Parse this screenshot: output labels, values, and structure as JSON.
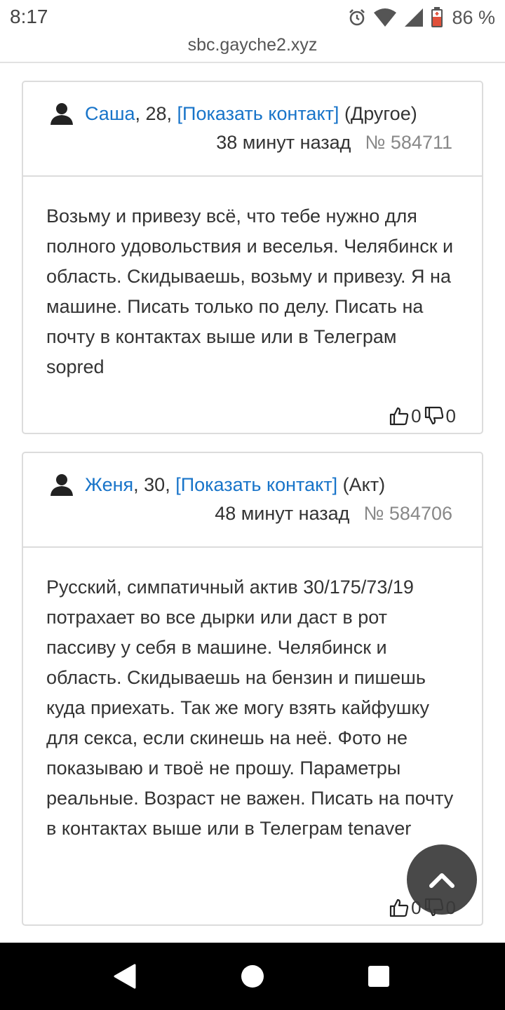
{
  "status_bar": {
    "time": "8:17",
    "battery_percent": "86 %",
    "icons": [
      "alarm-icon",
      "wifi-icon",
      "signal-icon",
      "battery-charging-icon"
    ]
  },
  "browser": {
    "url": "sbc.gayche2.xyz"
  },
  "posts": [
    {
      "name": "Саша",
      "age_sep": ", 28, ",
      "contact_link": "[Показать контакт]",
      "role": " (Другое)",
      "time_ago": "38 минут назад",
      "number": "№ 584711",
      "body": "Возьму и привезу всё, что тебе нужно для полного удовольствия и веселья. Челябинск и область. Скидываешь, возьму и привезу. Я на машине. Писать только по делу. Писать на почту в контактах выше или в Телеграм sopred",
      "likes": "0",
      "dislikes": "0"
    },
    {
      "name": "Женя",
      "age_sep": ", 30, ",
      "contact_link": "[Показать контакт]",
      "role": " (Акт)",
      "time_ago": "48 минут назад",
      "number": "№ 584706",
      "body": "Русский, симпатичный актив 30/175/73/19 потрахает во все дырки или даст в рот пассиву у себя в машине. Челябинск и область. Скидываешь на бензин и пишешь куда приехать. Так же могу взять кайфушку для секса, если скинешь на неё. Фото не показываю и твоё не прошу. Параметры реальные. Возраст не важен. Писать на почту в контактах выше или в Телеграм tenaver",
      "likes": "0",
      "dislikes": "0"
    }
  ],
  "ui": {
    "scroll_top_icon": "chevron-up-icon",
    "nav_icons": [
      "back-icon",
      "home-icon",
      "recents-icon"
    ]
  }
}
